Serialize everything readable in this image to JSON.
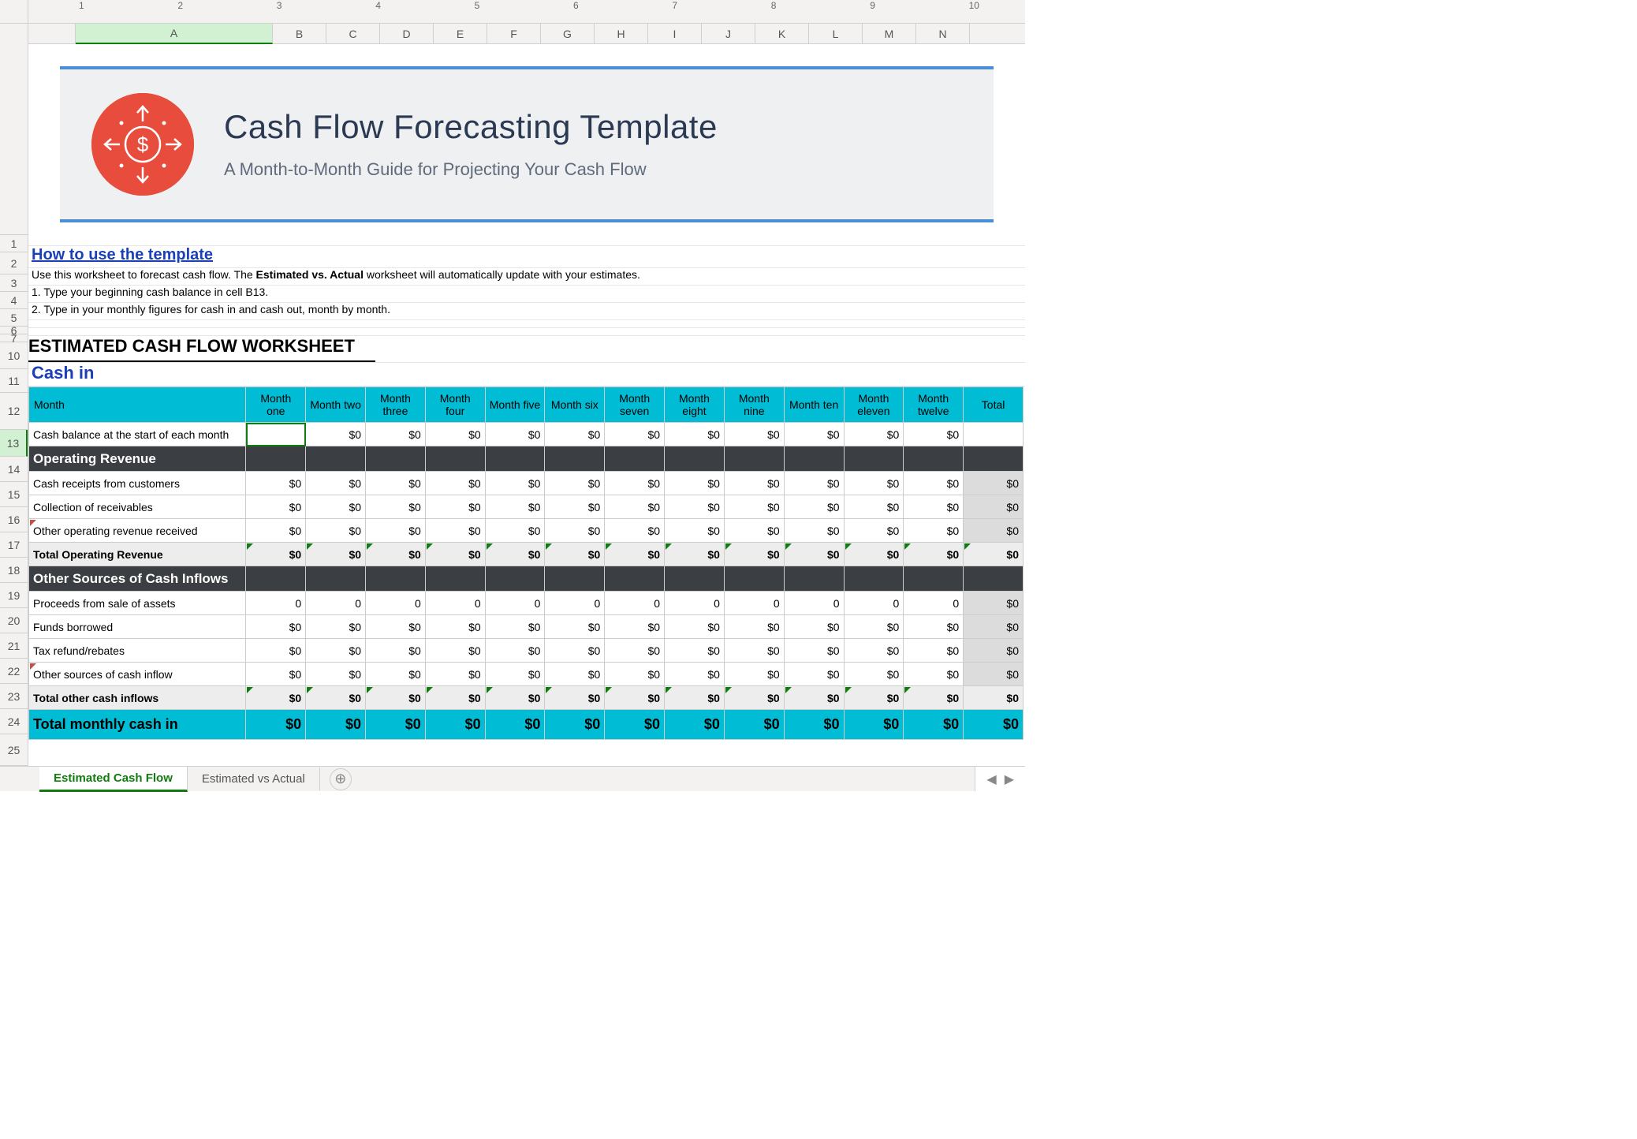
{
  "columns": [
    "A",
    "B",
    "C",
    "D",
    "E",
    "F",
    "G",
    "H",
    "I",
    "J",
    "K",
    "L",
    "M",
    "N"
  ],
  "rowNums": [
    1,
    2,
    3,
    4,
    5,
    6,
    7,
    10,
    11,
    12,
    13,
    14,
    15,
    16,
    17,
    18,
    19,
    20,
    21,
    22,
    23,
    24,
    25
  ],
  "rulerNums": [
    1,
    2,
    3,
    4,
    5,
    6,
    7,
    8,
    9,
    10
  ],
  "banner": {
    "title": "Cash Flow Forecasting Template",
    "subtitle": "A Month-to-Month Guide for Projecting Your Cash Flow"
  },
  "howTo": {
    "heading": "How to use the template",
    "line1a": "Use this worksheet to forecast cash flow. The ",
    "line1b": "Estimated vs. Actual",
    "line1c": " worksheet will automatically update with your estimates.",
    "line2": "1. Type your beginning cash balance in cell B13.",
    "line3": "2. Type in your monthly figures for cash in and cash out, month by month."
  },
  "worksheetTitle": "ESTIMATED CASH FLOW WORKSHEET",
  "cashInHeading": "Cash in",
  "headerRow": {
    "label": "Month",
    "months": [
      "Month one",
      "Month two",
      "Month three",
      "Month four",
      "Month five",
      "Month six",
      "Month seven",
      "Month eight",
      "Month nine",
      "Month ten",
      "Month eleven",
      "Month twelve"
    ],
    "total": "Total"
  },
  "row13": {
    "label": "Cash balance at the start of each month",
    "values": [
      "",
      "$0",
      "$0",
      "$0",
      "$0",
      "$0",
      "$0",
      "$0",
      "$0",
      "$0",
      "$0",
      "$0",
      ""
    ]
  },
  "sectionA": {
    "title": "Operating Revenue"
  },
  "rowsA": [
    {
      "label": "Cash receipts from customers",
      "values": [
        "$0",
        "$0",
        "$0",
        "$0",
        "$0",
        "$0",
        "$0",
        "$0",
        "$0",
        "$0",
        "$0",
        "$0",
        "$0"
      ]
    },
    {
      "label": "Collection of receivables",
      "values": [
        "$0",
        "$0",
        "$0",
        "$0",
        "$0",
        "$0",
        "$0",
        "$0",
        "$0",
        "$0",
        "$0",
        "$0",
        "$0"
      ]
    },
    {
      "label": "Other operating revenue received",
      "values": [
        "$0",
        "$0",
        "$0",
        "$0",
        "$0",
        "$0",
        "$0",
        "$0",
        "$0",
        "$0",
        "$0",
        "$0",
        "$0"
      ]
    }
  ],
  "totalA": {
    "label": "Total Operating Revenue",
    "values": [
      "$0",
      "$0",
      "$0",
      "$0",
      "$0",
      "$0",
      "$0",
      "$0",
      "$0",
      "$0",
      "$0",
      "$0",
      "$0"
    ]
  },
  "sectionB": {
    "title": "Other Sources of Cash Inflows"
  },
  "rowsB": [
    {
      "label": "Proceeds from sale of assets",
      "values": [
        "0",
        "0",
        "0",
        "0",
        "0",
        "0",
        "0",
        "0",
        "0",
        "0",
        "0",
        "0",
        "$0"
      ]
    },
    {
      "label": "Funds borrowed",
      "values": [
        "$0",
        "$0",
        "$0",
        "$0",
        "$0",
        "$0",
        "$0",
        "$0",
        "$0",
        "$0",
        "$0",
        "$0",
        "$0"
      ]
    },
    {
      "label": "Tax refund/rebates",
      "values": [
        "$0",
        "$0",
        "$0",
        "$0",
        "$0",
        "$0",
        "$0",
        "$0",
        "$0",
        "$0",
        "$0",
        "$0",
        "$0"
      ]
    },
    {
      "label": "Other sources of cash inflow",
      "values": [
        "$0",
        "$0",
        "$0",
        "$0",
        "$0",
        "$0",
        "$0",
        "$0",
        "$0",
        "$0",
        "$0",
        "$0",
        "$0"
      ]
    }
  ],
  "totalB": {
    "label": "Total other cash inflows",
    "values": [
      "$0",
      "$0",
      "$0",
      "$0",
      "$0",
      "$0",
      "$0",
      "$0",
      "$0",
      "$0",
      "$0",
      "$0",
      "$0"
    ]
  },
  "grandTotal": {
    "label": "Total monthly cash in",
    "values": [
      "$0",
      "$0",
      "$0",
      "$0",
      "$0",
      "$0",
      "$0",
      "$0",
      "$0",
      "$0",
      "$0",
      "$0",
      "$0"
    ]
  },
  "tabs": {
    "active": "Estimated Cash Flow",
    "other": "Estimated vs Actual"
  }
}
